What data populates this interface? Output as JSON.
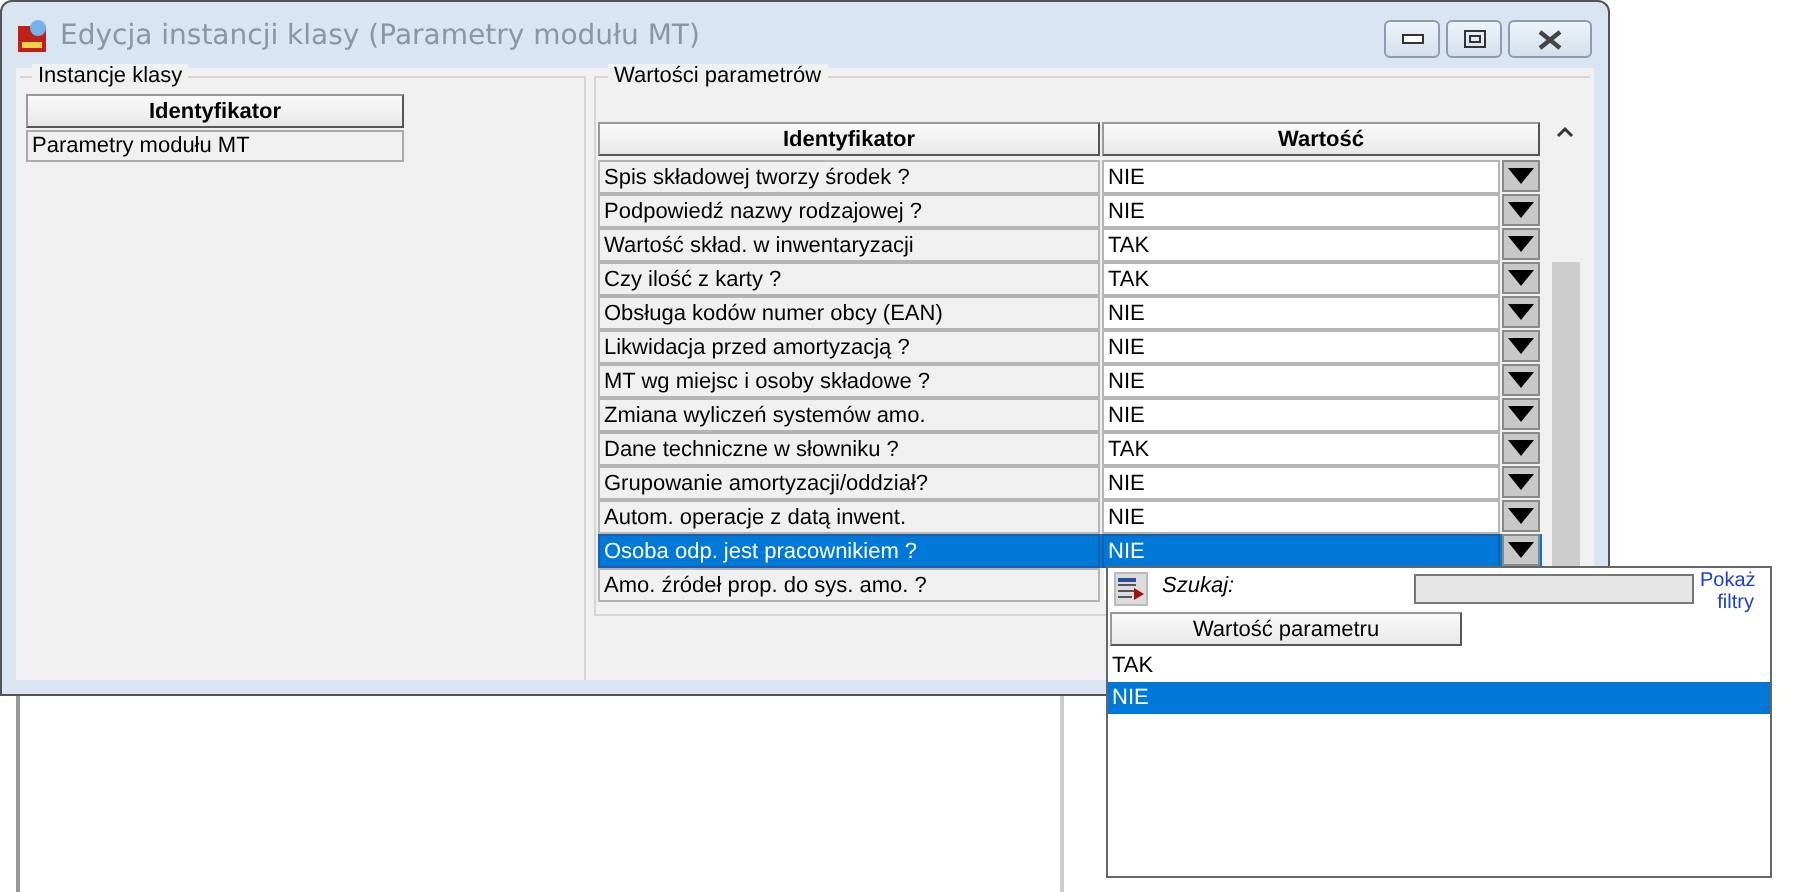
{
  "window": {
    "title": "Edycja instancji klasy (Parametry modułu MT)"
  },
  "instances": {
    "title": "Instancje klasy",
    "column": "Identyfikator",
    "rows": [
      {
        "label": "Parametry modułu MT",
        "selected": false
      }
    ]
  },
  "parameters": {
    "title": "Wartości parametrów",
    "columns": [
      "Identyfikator",
      "Wartość"
    ],
    "rows": [
      {
        "name": "Spis składowej tworzy środek ?",
        "value": "NIE",
        "selected": false
      },
      {
        "name": "Podpowiedź nazwy rodzajowej ?",
        "value": "NIE",
        "selected": false
      },
      {
        "name": "Wartość skład. w inwentaryzacji",
        "value": "TAK",
        "selected": false
      },
      {
        "name": "Czy ilość z karty ?",
        "value": "TAK",
        "selected": false
      },
      {
        "name": "Obsługa kodów numer obcy (EAN)",
        "value": "NIE",
        "selected": false
      },
      {
        "name": "Likwidacja przed amortyzacją ?",
        "value": "NIE",
        "selected": false
      },
      {
        "name": "MT wg miejsc i osoby składowe ?",
        "value": "NIE",
        "selected": false
      },
      {
        "name": "Zmiana wyliczeń systemów amo.",
        "value": "NIE",
        "selected": false
      },
      {
        "name": "Dane techniczne w słowniku ?",
        "value": "TAK",
        "selected": false
      },
      {
        "name": "Grupowanie amortyzacji/oddział?",
        "value": "NIE",
        "selected": false
      },
      {
        "name": "Autom. operacje z datą inwent.",
        "value": "NIE",
        "selected": false
      },
      {
        "name": "Osoba odp. jest pracownikiem ?",
        "value": "NIE",
        "selected": true
      },
      {
        "name": "Amo. źródeł prop. do sys. amo. ?",
        "selected": false
      }
    ]
  },
  "dropdown": {
    "search_label": "Szukaj:",
    "filters_link": "Pokaż filtry",
    "column": "Wartość parametru",
    "options": [
      {
        "label": "TAK",
        "selected": false
      },
      {
        "label": "NIE",
        "selected": true
      }
    ]
  }
}
